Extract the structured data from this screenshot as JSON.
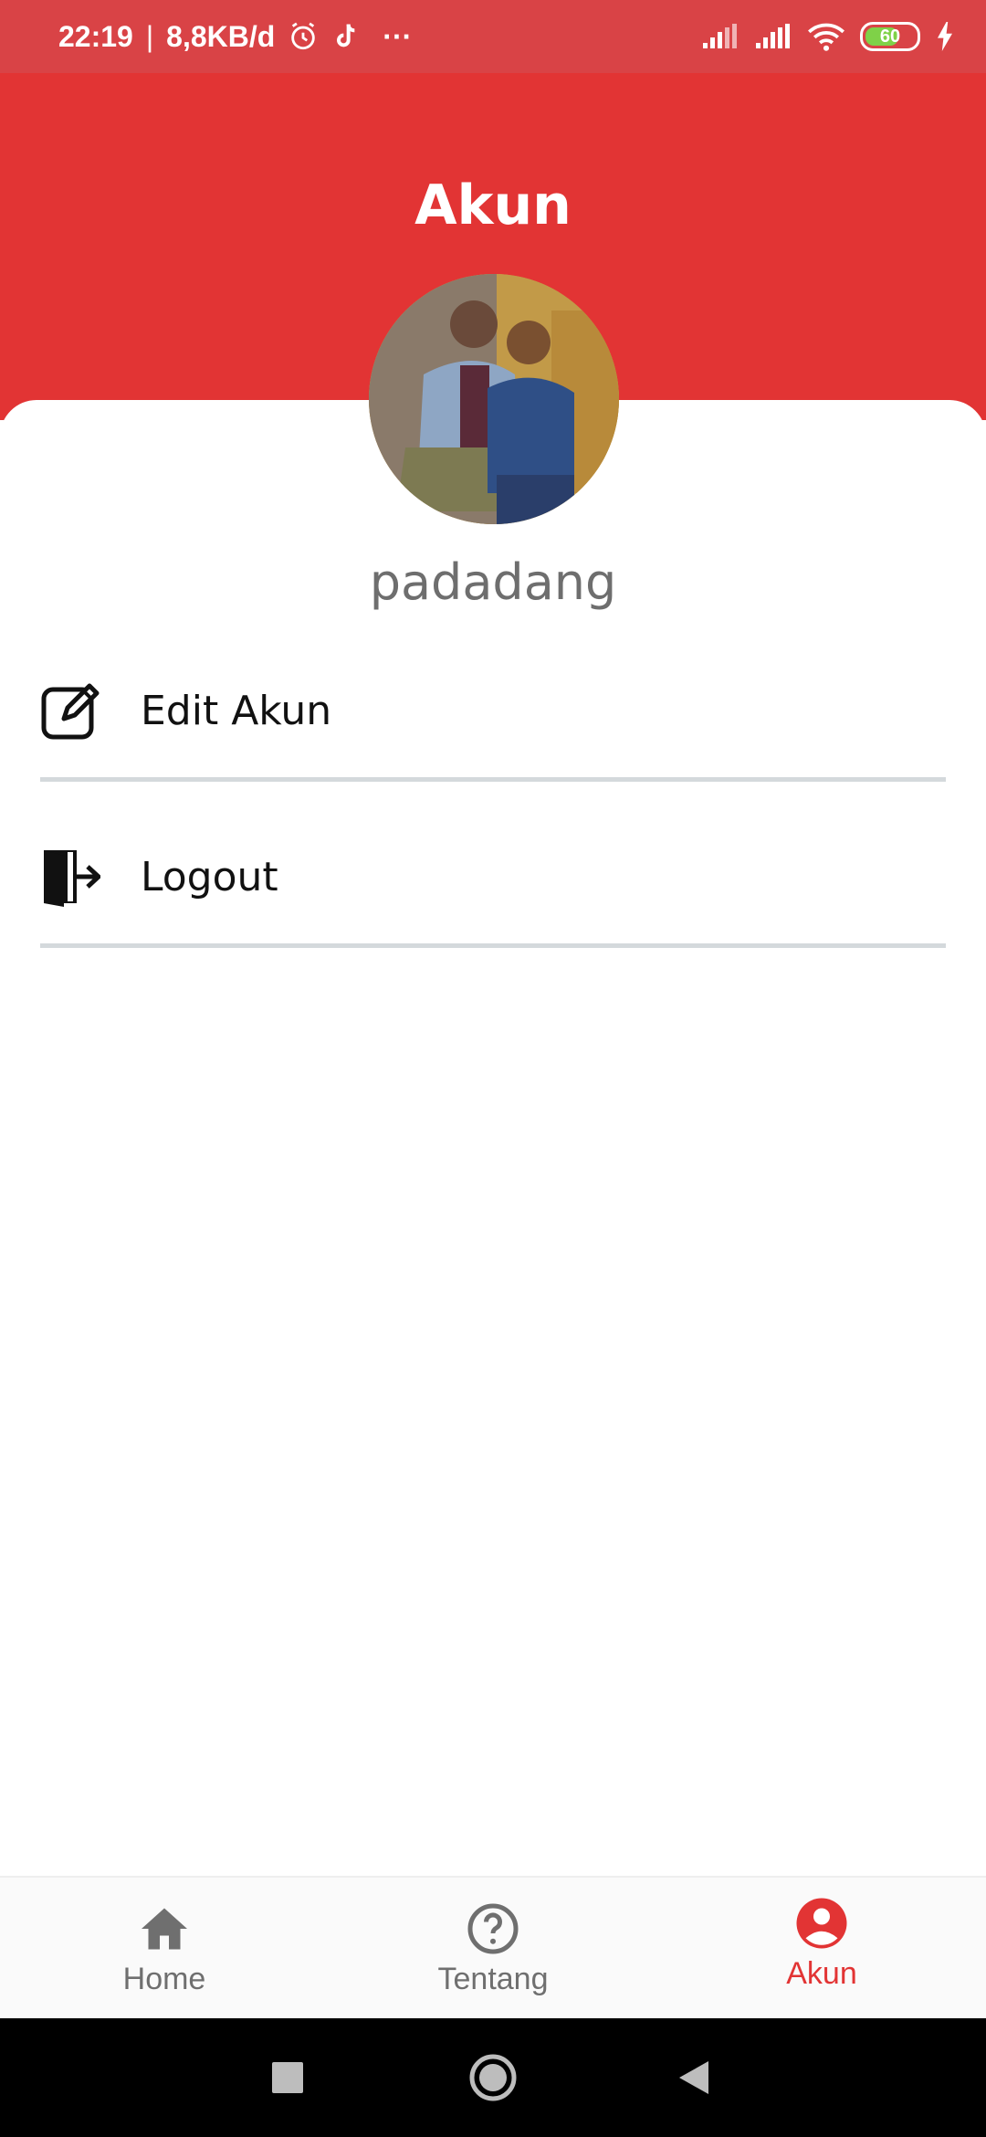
{
  "status_bar": {
    "time": "22:19",
    "separator": "|",
    "net_speed": "8,8KB/d",
    "more": "···",
    "battery": "60",
    "icons": [
      "alarm-icon",
      "tiktok-icon",
      "signal-icon",
      "signal-icon",
      "wifi-icon",
      "battery-icon",
      "charging-icon"
    ]
  },
  "header": {
    "title": "Akun"
  },
  "profile": {
    "username": "padadang"
  },
  "menu": {
    "items": [
      {
        "label": "Edit Akun",
        "icon": "edit-icon"
      },
      {
        "label": "Logout",
        "icon": "logout-icon"
      }
    ]
  },
  "bottom_nav": {
    "items": [
      {
        "label": "Home",
        "icon": "home-icon",
        "active": false
      },
      {
        "label": "Tentang",
        "icon": "help-circle-icon",
        "active": false
      },
      {
        "label": "Akun",
        "icon": "account-circle-icon",
        "active": true
      }
    ]
  },
  "colors": {
    "primary": "#e23434",
    "status_bar": "#d94346",
    "inactive": "#6f6f6f",
    "divider": "#d4d9dc"
  }
}
